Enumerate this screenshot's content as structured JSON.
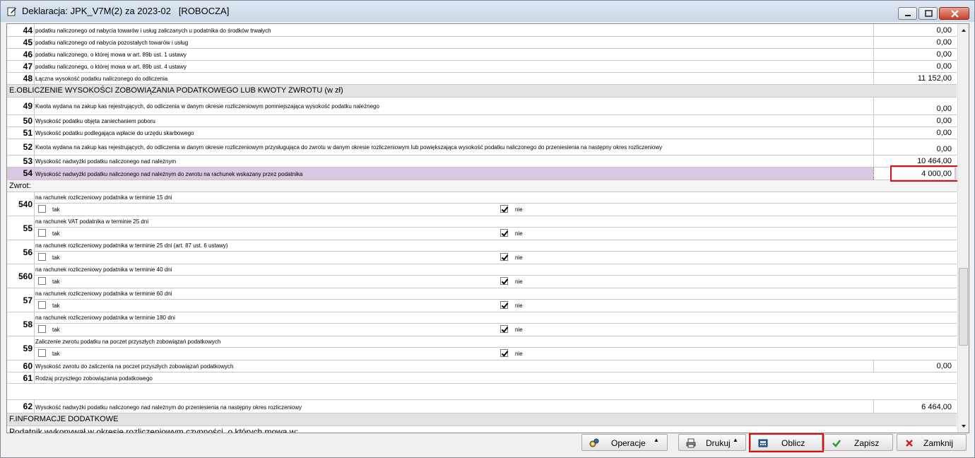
{
  "window": {
    "title": "Deklaracja: JPK_V7M(2) za 2023-02   [ROBOCZA]"
  },
  "rows_top": [
    {
      "num": "44",
      "desc": "podatku naliczonego od nabycia towarów i usług zaliczanych u podatnika do środków trwałych",
      "value": "0,00"
    },
    {
      "num": "45",
      "desc": "podatku naliczonego od nabycia pozostałych towarów i usług",
      "value": "0,00"
    },
    {
      "num": "46",
      "desc": "podatku naliczonego, o której mowa w art. 89b ust. 1 ustawy",
      "value": "0,00"
    },
    {
      "num": "47",
      "desc": "podatku naliczonego, o której mowa w art. 89b ust. 4 ustawy",
      "value": "0,00"
    },
    {
      "num": "48",
      "desc": "Łączna wysokość podatku naliczonego do odliczenia",
      "value": "11 152,00"
    }
  ],
  "section_e": "E.OBLICZENIE WYSOKOŚCI ZOBOWIĄZANIA PODATKOWEGO LUB KWOTY ZWROTU (w zł)",
  "rows_e": [
    {
      "num": "49",
      "desc": "Kwota wydana na zakup kas rejestrujących, do odliczenia w danym okresie rozliczeniowym pomniejszająca wysokość podatku należnego",
      "value": "0,00"
    },
    {
      "num": "50",
      "desc": "Wysokość podatku objęta zaniechaniem poboru",
      "value": "0,00"
    },
    {
      "num": "51",
      "desc": "Wysokość podatku podlegająca wpłacie do urzędu skarbowego",
      "value": "0,00"
    },
    {
      "num": "52",
      "desc": "Kwota wydana na zakup kas rejestrujących, do odliczenia w danym okresie rozliczeniowym przysługująca do zwrotu w danym okresie rozliczeniowym lub powiększająca wysokość podatku naliczonego do przeniesienia na następny okres rozliczeniowy",
      "value": "0,00"
    },
    {
      "num": "53",
      "desc": "Wysokość nadwyżki podatku naliczonego nad należnym",
      "value": "10 464,00"
    },
    {
      "num": "54",
      "desc": "Wysokość nadwyżki podatku naliczonego nad należnym do zwrotu na rachunek wskazany przez podatnika",
      "value": "4 000,00"
    }
  ],
  "zwrot_label": "Zwrot:",
  "zwrot_rows": [
    {
      "num": "540",
      "desc": "na rachunek rozliczeniowy podatnika w terminie 15 dni",
      "tak": "tak",
      "nie": "nie",
      "tak_checked": false,
      "nie_checked": true
    },
    {
      "num": "55",
      "desc": "na rachunek VAT podatnika w terminie 25 dni",
      "tak": "tak",
      "nie": "nie",
      "tak_checked": false,
      "nie_checked": true
    },
    {
      "num": "56",
      "desc": "na rachunek rozliczeniowy podatnika w terminie 25 dni (art. 87 ust. 6 ustawy)",
      "tak": "tak",
      "nie": "nie",
      "tak_checked": false,
      "nie_checked": true
    },
    {
      "num": "560",
      "desc": "na rachunek rozliczeniowy podatnika w terminie 40 dni",
      "tak": "tak",
      "nie": "nie",
      "tak_checked": false,
      "nie_checked": true
    },
    {
      "num": "57",
      "desc": "na rachunek rozliczeniowy podatnika w terminie 60 dni",
      "tak": "tak",
      "nie": "nie",
      "tak_checked": false,
      "nie_checked": true
    },
    {
      "num": "58",
      "desc": "na rachunek rozliczeniowy podatnika w terminie 180 dni",
      "tak": "tak",
      "nie": "nie",
      "tak_checked": false,
      "nie_checked": true
    },
    {
      "num": "59",
      "desc": "Zaliczenie zwrotu podatku na poczet przyszłych zobowiązań podatkowych",
      "tak": "tak",
      "nie": "nie",
      "tak_checked": false,
      "nie_checked": true
    }
  ],
  "row60": {
    "num": "60",
    "desc": "Wysokość zwrotu do zaliczenia na poczet przyszłych zobowiązań podatkowych",
    "value": "0,00"
  },
  "row61": {
    "num": "61",
    "desc": "Rodzaj przyszłego zobowiązania podatkowego"
  },
  "row62": {
    "num": "62",
    "desc": "Wysokość nadwyżki podatku naliczonego nad należnym do przeniesienia na następny okres rozliczeniowy",
    "value": "6 464,00"
  },
  "section_f": "F.INFORMACJE DODATKOWE",
  "section_f_sub": "Podatnik wykonywał w okresie rozliczeniowym czynności, o których mowa w:",
  "buttons": {
    "operacje": "Operacje",
    "drukuj": "Drukuj",
    "oblicz": "Oblicz",
    "zapisz": "Zapisz",
    "zamknij": "Zamknij"
  },
  "colors": {
    "highlight_row": "#d8c8e0",
    "red_box": "#e01010",
    "section_bg": "#e3e3e3"
  }
}
